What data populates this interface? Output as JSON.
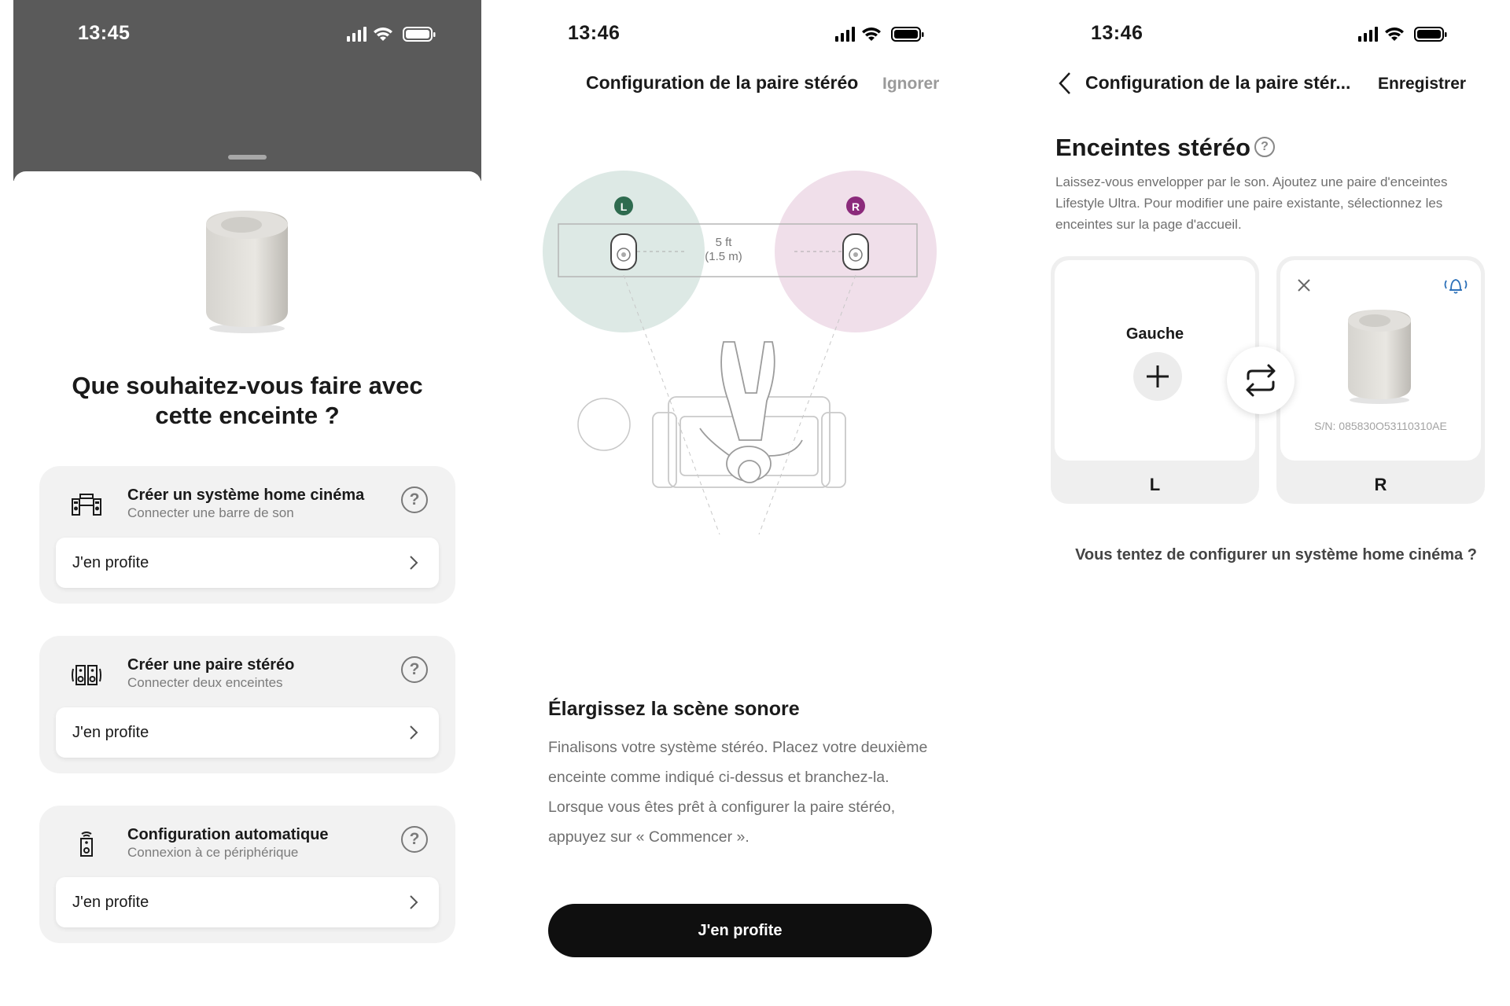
{
  "screen1": {
    "status_time": "13:45",
    "question": "Que souhaitez-vous faire avec cette enceinte ?",
    "options": [
      {
        "title": "Créer un système home cinéma",
        "subtitle": "Connecter une barre de son",
        "button": "J'en profite",
        "icon": "home-theater-icon"
      },
      {
        "title": "Créer une paire stéréo",
        "subtitle": "Connecter deux enceintes",
        "button": "J'en profite",
        "icon": "stereo-pair-icon"
      },
      {
        "title": "Configuration automatique",
        "subtitle": "Connexion à ce périphérique",
        "button": "J'en profite",
        "icon": "speaker-auto-icon"
      }
    ]
  },
  "screen2": {
    "status_time": "13:46",
    "title": "Configuration de la paire stéréo",
    "skip": "Ignorer",
    "left_badge": "L",
    "right_badge": "R",
    "distance_ft": "5 ft",
    "distance_m": "(1.5 m)",
    "heading": "Élargissez la scène sonore",
    "body": "Finalisons votre système stéréo. Placez votre deuxième enceinte comme indiqué ci-dessus et branchez-la. Lorsque vous êtes prêt à configurer la paire stéréo, appuyez sur « Commencer ».",
    "cta": "J'en profite"
  },
  "screen3": {
    "status_time": "13:46",
    "title": "Configuration de la paire stér...",
    "save": "Enregistrer",
    "heading": "Enceintes stéréo",
    "body": "Laissez-vous envelopper par le son. Ajoutez une paire d'enceintes Lifestyle Ultra. Pour modifier une paire existante, sélectionnez les enceintes sur la page d'accueil.",
    "left_slot_label": "Gauche",
    "left_letter": "L",
    "right_letter": "R",
    "serial": "S/N: 085830O53110310AE",
    "footer_link": "Vous tentez de configurer un système home cinéma ?"
  },
  "colors": {
    "left_green": "#2e6b4f",
    "right_purple": "#8b2a7b",
    "left_zone": "#dde9e5",
    "right_zone": "#f0dfea"
  }
}
